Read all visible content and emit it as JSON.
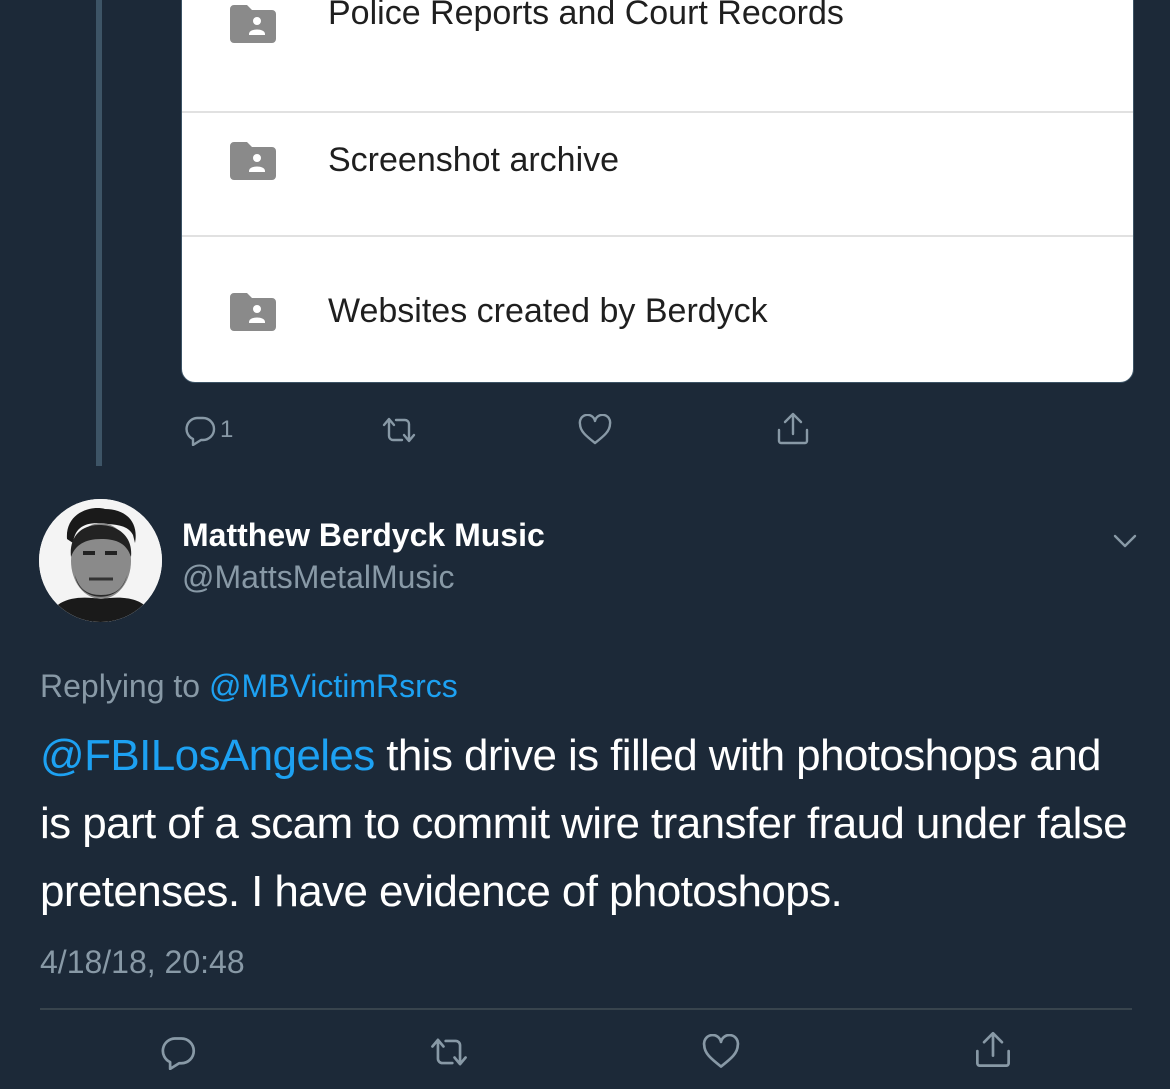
{
  "card": {
    "folders": [
      {
        "label": "Police Reports and Court Records",
        "icon": "shared-folder-icon"
      },
      {
        "label": "Screenshot archive",
        "icon": "shared-folder-icon"
      },
      {
        "label": "Websites created by Berdyck",
        "icon": "shared-folder-icon"
      }
    ]
  },
  "top_actions": {
    "reply_count": "1",
    "icons": [
      "reply-icon",
      "retweet-icon",
      "like-icon",
      "share-icon"
    ]
  },
  "tweet": {
    "display_name": "Matthew Berdyck Music",
    "handle": "@MattsMetalMusic",
    "replying_prefix": "Replying to",
    "replying_to": "@MBVictimRsrcs",
    "mention": "@FBILosAngeles",
    "text": " this drive is filled with photoshops and is part of a scam to commit wire transfer fraud under false pretenses. I have evidence of photoshops.",
    "timestamp": "4/18/18, 20:48"
  },
  "colors": {
    "background": "#1c2938",
    "link": "#1da1f2",
    "muted": "#8899a6",
    "thread_line": "#3d5466",
    "folder_icon": "#8a8a8a"
  }
}
